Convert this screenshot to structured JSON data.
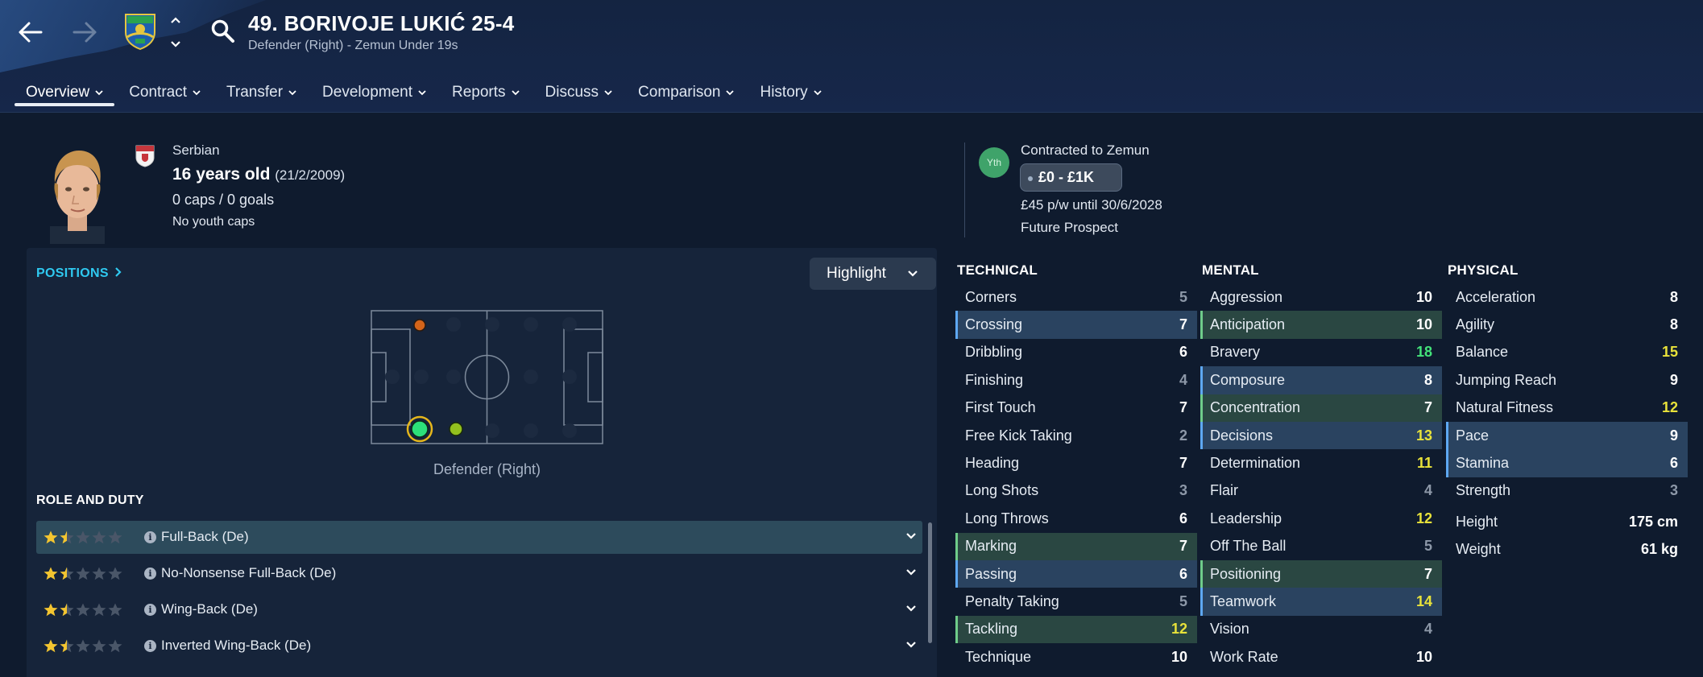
{
  "header": {
    "title": "49. BORIVOJE LUKIĆ 25-4",
    "subtitle": "Defender (Right) - Zemun Under 19s"
  },
  "tabs": [
    {
      "label": "Overview"
    },
    {
      "label": "Contract"
    },
    {
      "label": "Transfer"
    },
    {
      "label": "Development"
    },
    {
      "label": "Reports"
    },
    {
      "label": "Discuss"
    },
    {
      "label": "Comparison"
    },
    {
      "label": "History"
    }
  ],
  "profile": {
    "nationality": "Serbian",
    "age": "16 years old",
    "dob": "(21/2/2009)",
    "caps": "0 caps / 0 goals",
    "youth_caps": "No youth caps"
  },
  "contract": {
    "badge": "Yth",
    "club": "Contracted to Zemun",
    "value": "£0 - £1K",
    "wage": "£45 p/w until 30/6/2028",
    "status": "Future Prospect"
  },
  "positions": {
    "link": "POSITIONS",
    "highlight": "Highlight",
    "caption": "Defender (Right)"
  },
  "roles": {
    "title": "ROLE AND DUTY",
    "items": [
      {
        "label": "Full-Back (De)",
        "stars": 1.5
      },
      {
        "label": "No-Nonsense Full-Back (De)",
        "stars": 1.5
      },
      {
        "label": "Wing-Back (De)",
        "stars": 1.5
      },
      {
        "label": "Inverted Wing-Back (De)",
        "stars": 1.5
      }
    ]
  },
  "attributes": {
    "technical": {
      "title": "TECHNICAL",
      "rows": [
        {
          "label": "Corners",
          "value": "5"
        },
        {
          "label": "Crossing",
          "value": "7"
        },
        {
          "label": "Dribbling",
          "value": "6"
        },
        {
          "label": "Finishing",
          "value": "4"
        },
        {
          "label": "First Touch",
          "value": "7"
        },
        {
          "label": "Free Kick Taking",
          "value": "2"
        },
        {
          "label": "Heading",
          "value": "7"
        },
        {
          "label": "Long Shots",
          "value": "3"
        },
        {
          "label": "Long Throws",
          "value": "6"
        },
        {
          "label": "Marking",
          "value": "7"
        },
        {
          "label": "Passing",
          "value": "6"
        },
        {
          "label": "Penalty Taking",
          "value": "5"
        },
        {
          "label": "Tackling",
          "value": "12"
        },
        {
          "label": "Technique",
          "value": "10"
        }
      ]
    },
    "mental": {
      "title": "MENTAL",
      "rows": [
        {
          "label": "Aggression",
          "value": "10"
        },
        {
          "label": "Anticipation",
          "value": "10"
        },
        {
          "label": "Bravery",
          "value": "18"
        },
        {
          "label": "Composure",
          "value": "8"
        },
        {
          "label": "Concentration",
          "value": "7"
        },
        {
          "label": "Decisions",
          "value": "13"
        },
        {
          "label": "Determination",
          "value": "11"
        },
        {
          "label": "Flair",
          "value": "4"
        },
        {
          "label": "Leadership",
          "value": "12"
        },
        {
          "label": "Off The Ball",
          "value": "5"
        },
        {
          "label": "Positioning",
          "value": "7"
        },
        {
          "label": "Teamwork",
          "value": "14"
        },
        {
          "label": "Vision",
          "value": "4"
        },
        {
          "label": "Work Rate",
          "value": "10"
        }
      ]
    },
    "physical": {
      "title": "PHYSICAL",
      "rows": [
        {
          "label": "Acceleration",
          "value": "8"
        },
        {
          "label": "Agility",
          "value": "8"
        },
        {
          "label": "Balance",
          "value": "15"
        },
        {
          "label": "Jumping Reach",
          "value": "9"
        },
        {
          "label": "Natural Fitness",
          "value": "12"
        },
        {
          "label": "Pace",
          "value": "9"
        },
        {
          "label": "Stamina",
          "value": "6"
        },
        {
          "label": "Strength",
          "value": "3"
        }
      ],
      "height_label": "Height",
      "height": "175 cm",
      "weight_label": "Weight",
      "weight": "61 kg"
    }
  }
}
